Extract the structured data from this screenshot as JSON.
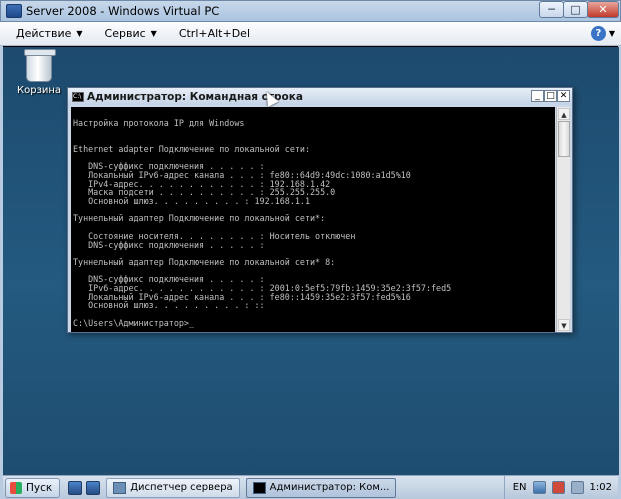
{
  "vpc": {
    "title": "Server 2008 - Windows Virtual PC",
    "controls": {
      "minimize": "─",
      "maximize": "□",
      "close": "✕"
    },
    "menu": [
      {
        "label": "Действие",
        "arrow": "▼"
      },
      {
        "label": "Сервис",
        "arrow": "▼"
      },
      {
        "label": "Ctrl+Alt+Del",
        "arrow": ""
      }
    ],
    "help": {
      "label": "?",
      "arrow": "▼"
    }
  },
  "desktop": {
    "recycle_bin_label": "Корзина"
  },
  "cmd": {
    "icon_text": "C:\\",
    "title": "Администратор: Командная строка",
    "controls": {
      "minimize": "_",
      "maximize": "□",
      "close": "✕"
    },
    "lines": [
      "",
      "Настройка протокола IP для Windows",
      "",
      "",
      "Ethernet adapter Подключение по локальной сети:",
      "",
      "   DNS-суффикс подключения . . . . . :",
      "   Локальный IPv6-адрес канала . . . : fe80::64d9:49dc:1080:a1d5%10",
      "   IPv4-адрес. . . . . . . . . . . . : 192.168.1.42",
      "   Маска подсети . . . . . . . . . . : 255.255.255.0",
      "   Основной шлюз. . . . . . . . . : 192.168.1.1",
      "",
      "Туннельный адаптер Подключение по локальной сети*:",
      "",
      "   Состояние носителя. . . . . . . . : Носитель отключен",
      "   DNS-суффикс подключения . . . . . :",
      "",
      "Туннельный адаптер Подключение по локальной сети* 8:",
      "",
      "   DNS-суффикс подключения . . . . . :",
      "   IPv6-адрес. . . . . . . . . . . . : 2001:0:5ef5:79fb:1459:35e2:3f57:fed5",
      "   Локальный IPv6-адрес канала . . . : fe80::1459:35e2:3f57:fed5%16",
      "   Основной шлюз. . . . . . . . . : ::",
      "",
      "C:\\Users\\Администратор>_"
    ]
  },
  "taskbar": {
    "start_label": "Пуск",
    "items": [
      {
        "label": "Диспетчер сервера",
        "active": false
      },
      {
        "label": "Администратор: Ком...",
        "active": true
      }
    ],
    "tray": {
      "lang": "EN",
      "time": "1:02"
    }
  }
}
